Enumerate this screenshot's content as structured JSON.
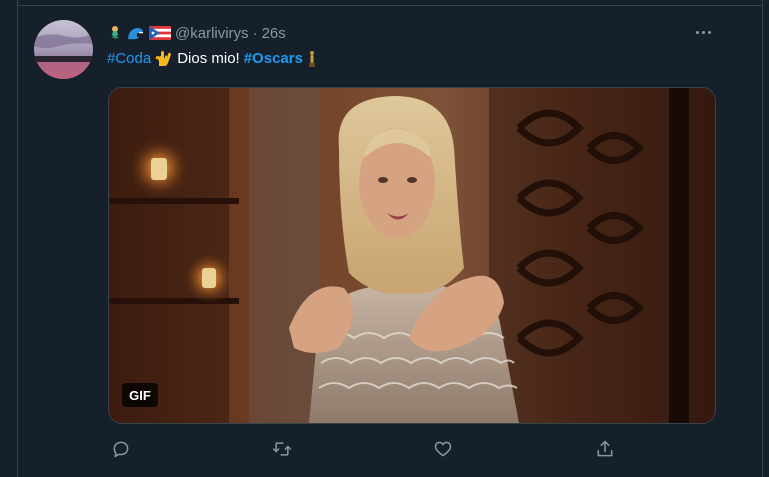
{
  "tweet": {
    "emojis": [
      "mermaid-emoji",
      "wave-emoji",
      "puerto-rico-flag-emoji"
    ],
    "handle": "@karlivirys",
    "separator": "·",
    "time": "26s",
    "text_parts": [
      {
        "kind": "hashtag",
        "text": "#Coda"
      },
      {
        "kind": "emoji",
        "name": "love-you-gesture-emoji"
      },
      {
        "kind": "plain",
        "text": "Dios mio!"
      },
      {
        "kind": "hashtag-bold",
        "text": "#Oscars"
      },
      {
        "kind": "emoji",
        "name": "trophy-statue-emoji"
      }
    ],
    "media": {
      "badge": "GIF"
    },
    "colors": {
      "background": "#15202b",
      "accent": "#1d9bf0",
      "muted": "#8899a6",
      "border": "#38444d"
    },
    "actions": [
      "reply-icon",
      "retweet-icon",
      "like-icon",
      "share-icon"
    ]
  }
}
